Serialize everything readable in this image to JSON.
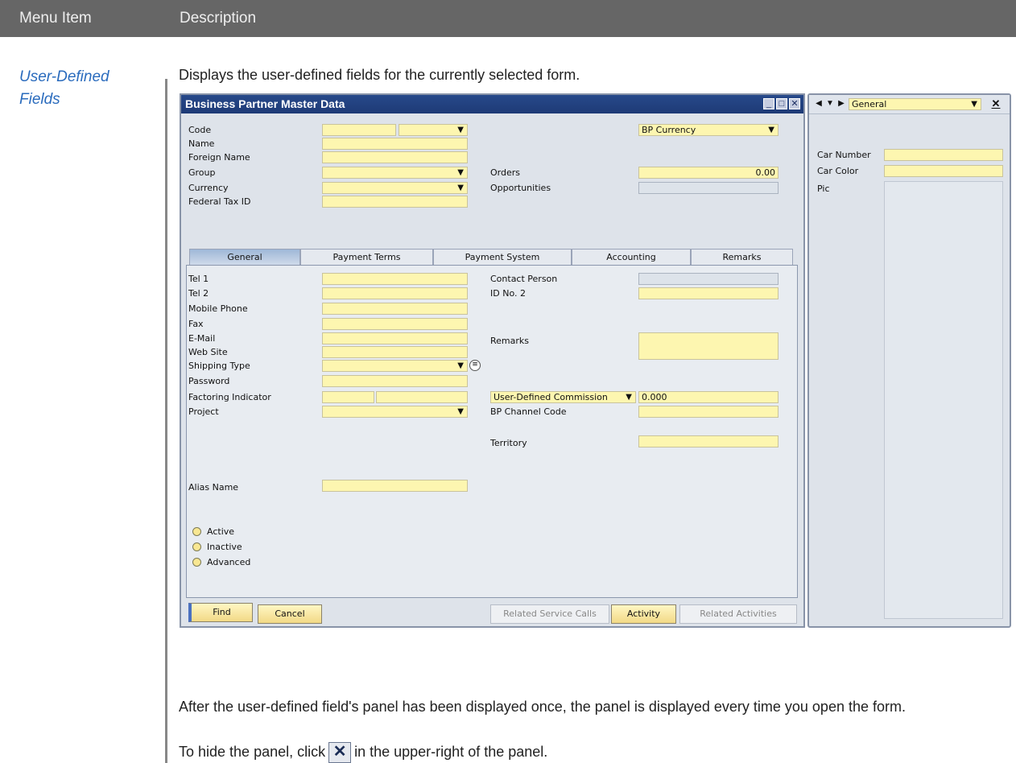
{
  "header": {
    "menu_item": "Menu Item",
    "description": "Description"
  },
  "menu_item": {
    "label": "User-Defined Fields"
  },
  "intro_text": "Displays the user-defined fields for the currently selected form.",
  "after_text_1": "After the user-defined field's panel has been displayed once, the panel is displayed every time you open the form.",
  "after_text_2_pre": "To hide the panel, click",
  "after_text_2_post": "in the upper-right of the panel.",
  "window": {
    "title": "Business Partner Master Data",
    "header_labels": [
      "Code",
      "Name",
      "Foreign Name",
      "Group",
      "Currency",
      "Federal Tax ID"
    ],
    "bp_currency": "BP Currency",
    "orders_label": "Orders",
    "orders_value": "0.00",
    "opportunities_label": "Opportunities",
    "tabs": [
      "General",
      "Payment Terms",
      "Payment System",
      "Accounting",
      "Remarks"
    ],
    "left_labels": [
      "Tel 1",
      "Tel 2",
      "Mobile Phone",
      "Fax",
      "E-Mail",
      "Web Site",
      "Shipping Type",
      "Password",
      "Factoring Indicator",
      "Project"
    ],
    "alias_label": "Alias Name",
    "right_labels": {
      "contact": "Contact Person",
      "id2": "ID No. 2",
      "remarks": "Remarks",
      "channel": "BP Channel Code",
      "territory": "Territory"
    },
    "commission_select": "User-Defined Commission",
    "commission_value": "0.000",
    "radios": [
      "Active",
      "Inactive",
      "Advanced"
    ],
    "buttons": {
      "find": "Find",
      "cancel": "Cancel",
      "related_calls": "Related Service Calls",
      "activity": "Activity",
      "related_activities": "Related Activities"
    }
  },
  "udf_panel": {
    "category": "General",
    "labels": [
      "Car Number",
      "Car Color",
      "Pic"
    ]
  },
  "hide_icon": "close-x-icon"
}
